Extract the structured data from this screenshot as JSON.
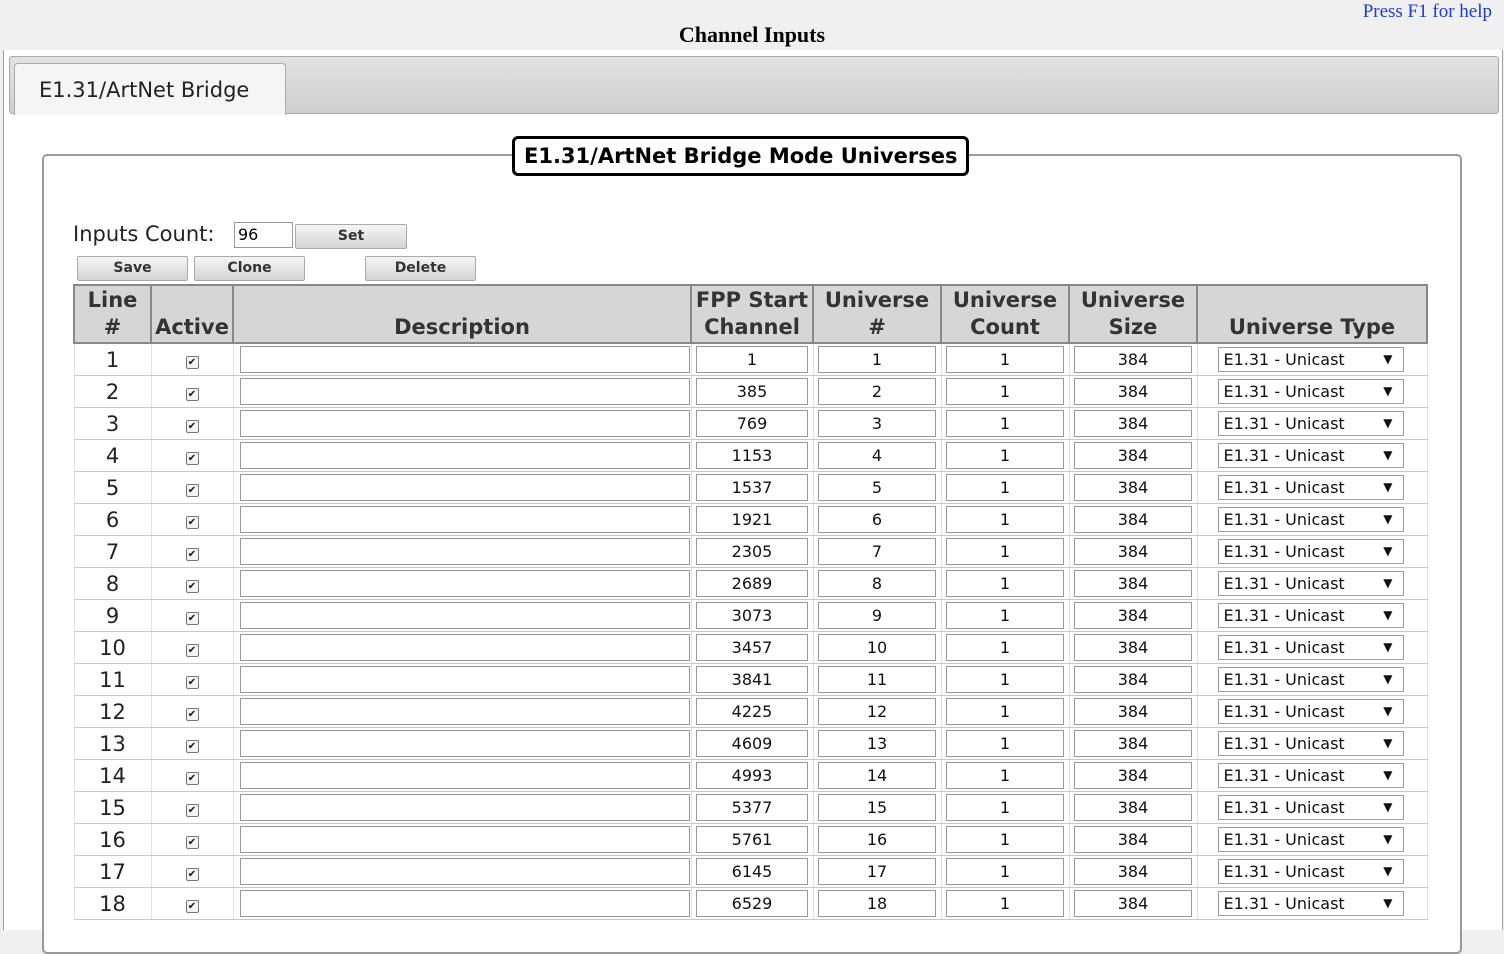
{
  "header": {
    "help_text": "Press F1 for help",
    "title": "Channel Inputs"
  },
  "tabs": [
    {
      "label": "E1.31/ArtNet Bridge",
      "selected": true
    }
  ],
  "panel": {
    "legend": "E1.31/ArtNet Bridge Mode Universes",
    "inputs_count_label": "Inputs Count:",
    "inputs_count_value": "96",
    "buttons": {
      "set": "Set",
      "save": "Save",
      "clone": "Clone",
      "delete": "Delete"
    }
  },
  "table": {
    "headers": {
      "line": "Line #",
      "active": "Active",
      "description": "Description",
      "start_channel": "FPP Start Channel",
      "universe": "Universe #",
      "universe_count": "Universe Count",
      "universe_size": "Universe Size",
      "universe_type": "Universe Type"
    },
    "rows": [
      {
        "line": "1",
        "active": true,
        "description": "",
        "start": "1",
        "universe": "1",
        "count": "1",
        "size": "384",
        "type": "E1.31 - Unicast"
      },
      {
        "line": "2",
        "active": true,
        "description": "",
        "start": "385",
        "universe": "2",
        "count": "1",
        "size": "384",
        "type": "E1.31 - Unicast"
      },
      {
        "line": "3",
        "active": true,
        "description": "",
        "start": "769",
        "universe": "3",
        "count": "1",
        "size": "384",
        "type": "E1.31 - Unicast"
      },
      {
        "line": "4",
        "active": true,
        "description": "",
        "start": "1153",
        "universe": "4",
        "count": "1",
        "size": "384",
        "type": "E1.31 - Unicast"
      },
      {
        "line": "5",
        "active": true,
        "description": "",
        "start": "1537",
        "universe": "5",
        "count": "1",
        "size": "384",
        "type": "E1.31 - Unicast"
      },
      {
        "line": "6",
        "active": true,
        "description": "",
        "start": "1921",
        "universe": "6",
        "count": "1",
        "size": "384",
        "type": "E1.31 - Unicast"
      },
      {
        "line": "7",
        "active": true,
        "description": "",
        "start": "2305",
        "universe": "7",
        "count": "1",
        "size": "384",
        "type": "E1.31 - Unicast"
      },
      {
        "line": "8",
        "active": true,
        "description": "",
        "start": "2689",
        "universe": "8",
        "count": "1",
        "size": "384",
        "type": "E1.31 - Unicast"
      },
      {
        "line": "9",
        "active": true,
        "description": "",
        "start": "3073",
        "universe": "9",
        "count": "1",
        "size": "384",
        "type": "E1.31 - Unicast"
      },
      {
        "line": "10",
        "active": true,
        "description": "",
        "start": "3457",
        "universe": "10",
        "count": "1",
        "size": "384",
        "type": "E1.31 - Unicast"
      },
      {
        "line": "11",
        "active": true,
        "description": "",
        "start": "3841",
        "universe": "11",
        "count": "1",
        "size": "384",
        "type": "E1.31 - Unicast"
      },
      {
        "line": "12",
        "active": true,
        "description": "",
        "start": "4225",
        "universe": "12",
        "count": "1",
        "size": "384",
        "type": "E1.31 - Unicast"
      },
      {
        "line": "13",
        "active": true,
        "description": "",
        "start": "4609",
        "universe": "13",
        "count": "1",
        "size": "384",
        "type": "E1.31 - Unicast"
      },
      {
        "line": "14",
        "active": true,
        "description": "",
        "start": "4993",
        "universe": "14",
        "count": "1",
        "size": "384",
        "type": "E1.31 - Unicast"
      },
      {
        "line": "15",
        "active": true,
        "description": "",
        "start": "5377",
        "universe": "15",
        "count": "1",
        "size": "384",
        "type": "E1.31 - Unicast"
      },
      {
        "line": "16",
        "active": true,
        "description": "",
        "start": "5761",
        "universe": "16",
        "count": "1",
        "size": "384",
        "type": "E1.31 - Unicast"
      },
      {
        "line": "17",
        "active": true,
        "description": "",
        "start": "6145",
        "universe": "17",
        "count": "1",
        "size": "384",
        "type": "E1.31 - Unicast"
      },
      {
        "line": "18",
        "active": true,
        "description": "",
        "start": "6529",
        "universe": "18",
        "count": "1",
        "size": "384",
        "type": "E1.31 - Unicast"
      }
    ]
  }
}
